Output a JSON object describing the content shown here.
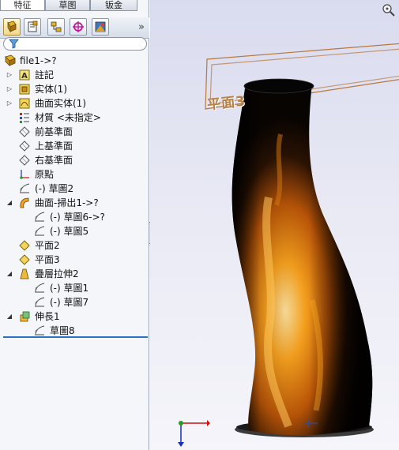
{
  "tabs": [
    {
      "label": "特征",
      "active": true
    },
    {
      "label": "草图",
      "active": false
    },
    {
      "label": "钣金",
      "active": false
    }
  ],
  "toolbar": {
    "buttons": [
      {
        "icon": "feature-manager-icon",
        "active": true
      },
      {
        "icon": "property-manager-icon",
        "active": false
      },
      {
        "icon": "configuration-manager-icon",
        "active": false
      },
      {
        "icon": "dimxpert-icon",
        "active": false
      },
      {
        "icon": "display-manager-icon",
        "active": false
      }
    ],
    "more": "»"
  },
  "filter": {
    "icon": "filter-icon",
    "value": ""
  },
  "tree": [
    {
      "label": "file1->?",
      "icon": "part-icon",
      "expander": "",
      "level": 0
    },
    {
      "label": "註記",
      "icon": "annotations-icon",
      "expander": "▷",
      "level": 1
    },
    {
      "label": "实体(1)",
      "icon": "solid-bodies-icon",
      "expander": "▷",
      "level": 1
    },
    {
      "label": "曲面实体(1)",
      "icon": "surface-bodies-icon",
      "expander": "▷",
      "level": 1
    },
    {
      "label": "材質 <未指定>",
      "icon": "material-icon",
      "expander": "",
      "level": 1
    },
    {
      "label": "前基準面",
      "icon": "plane-icon",
      "expander": "",
      "level": 1
    },
    {
      "label": "上基準面",
      "icon": "plane-icon",
      "expander": "",
      "level": 1
    },
    {
      "label": "右基準面",
      "icon": "plane-icon",
      "expander": "",
      "level": 1
    },
    {
      "label": "原點",
      "icon": "origin-icon",
      "expander": "",
      "level": 1
    },
    {
      "label": "(-) 草圖2",
      "icon": "sketch-icon",
      "expander": "",
      "level": 1
    },
    {
      "label": "曲面-掃出1->?",
      "icon": "surface-sweep-icon",
      "expander": "◢",
      "level": 1
    },
    {
      "label": "(-) 草圖6->?",
      "icon": "sketch-icon",
      "expander": "",
      "level": 2
    },
    {
      "label": "(-) 草圖5",
      "icon": "sketch-icon",
      "expander": "",
      "level": 2
    },
    {
      "label": "平面2",
      "icon": "plane-feature-icon",
      "expander": "",
      "level": 1
    },
    {
      "label": "平面3",
      "icon": "plane-feature-icon",
      "expander": "",
      "level": 1
    },
    {
      "label": "疊層拉伸2",
      "icon": "loft-icon",
      "expander": "◢",
      "level": 1
    },
    {
      "label": "(-) 草圖1",
      "icon": "sketch-icon",
      "expander": "",
      "level": 2
    },
    {
      "label": "(-) 草圖7",
      "icon": "sketch-icon",
      "expander": "",
      "level": 2
    },
    {
      "label": "伸長1",
      "icon": "extrude-icon",
      "expander": "◢",
      "level": 1
    },
    {
      "label": "草圖8",
      "icon": "sketch-icon",
      "expander": "",
      "level": 2
    }
  ],
  "viewport": {
    "plane_label": "平面3",
    "background_top": "#d9dbef",
    "background_bottom": "#f5f5fa",
    "model_colors": [
      "#0a0703",
      "#f29a1c",
      "#ffd27a"
    ],
    "icons": [
      "zoom-view-icon",
      "triad-icon",
      "origin-marker-icon"
    ]
  },
  "colors": {
    "accent": "#2f6fc0",
    "plane_outline": "#b8773c"
  }
}
